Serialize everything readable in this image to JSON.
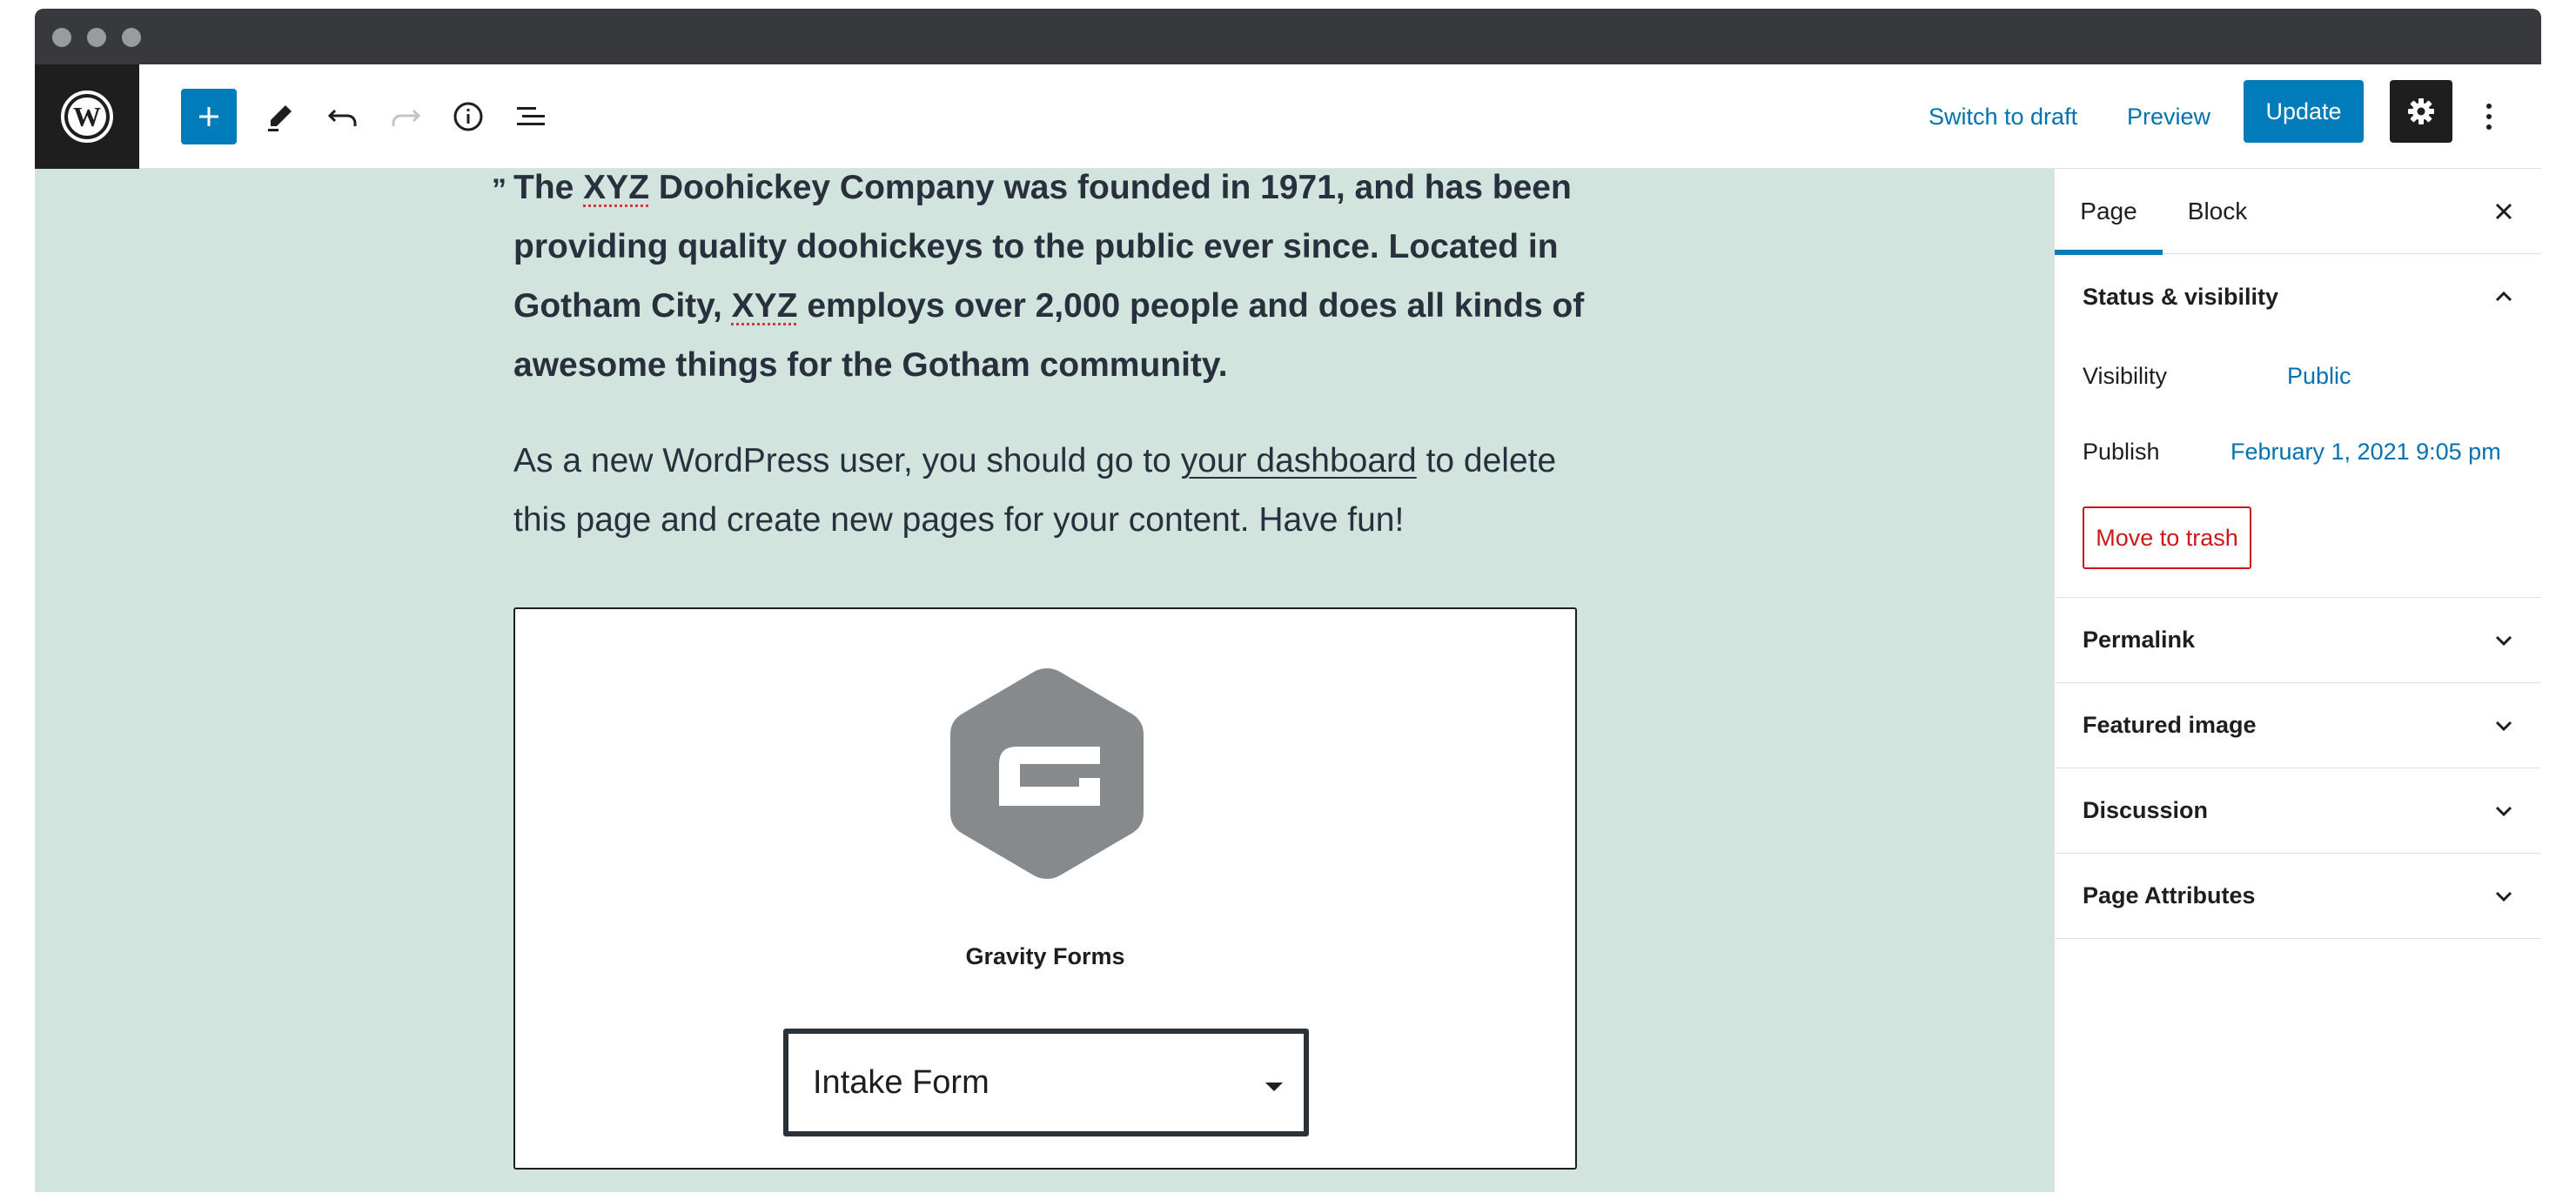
{
  "toolbar": {
    "switch_to_draft": "Switch to draft",
    "preview": "Preview",
    "update": "Update",
    "icons": [
      "wordpress-icon",
      "plus-icon",
      "pencil-icon",
      "undo-icon",
      "redo-icon",
      "info-icon",
      "list-view-icon",
      "gear-icon",
      "more-vertical-icon"
    ]
  },
  "content": {
    "quote": {
      "mark": "”",
      "part1": "The ",
      "xyz1": "XYZ",
      "part2": " Doohickey Company was founded in 1971, and has been providing quality doohickeys to the public ever since. Located in Gotham City, ",
      "xyz2": "XYZ",
      "part3": " employs over 2,000 people and does all kinds of awesome things for the Gotham community."
    },
    "paragraph": {
      "before": "As a new WordPress user, you should go to ",
      "link": "your dashboard",
      "after": " to delete this page and create new pages for your content. Have fun!"
    },
    "gravity_block": {
      "title": "Gravity Forms",
      "selected_form": "Intake Form"
    }
  },
  "sidebar": {
    "tabs": [
      "Page",
      "Block"
    ],
    "status_panel": {
      "title": "Status & visibility",
      "visibility_label": "Visibility",
      "visibility_value": "Public",
      "publish_label": "Publish",
      "publish_value": "February 1, 2021 9:05 pm",
      "trash": "Move to trash"
    },
    "panels": [
      "Permalink",
      "Featured image",
      "Discussion",
      "Page Attributes"
    ]
  },
  "colors": {
    "accent": "#007cba",
    "canvas_bg": "#d1e4dd",
    "danger": "#cc1818",
    "dark": "#1e1e1e"
  }
}
